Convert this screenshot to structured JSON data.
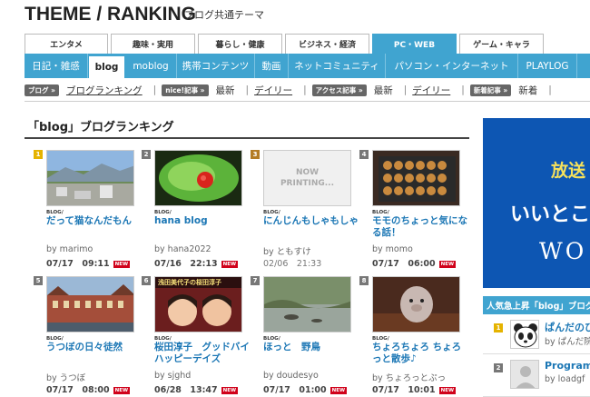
{
  "header": {
    "logo": "THEME / RANKING",
    "subtitle": "ブログ共通テーマ"
  },
  "category_tabs": [
    {
      "label": "エンタメ",
      "active": false
    },
    {
      "label": "趣味・実用",
      "active": false
    },
    {
      "label": "暮らし・健康",
      "active": false
    },
    {
      "label": "ビジネス・経済",
      "active": false
    },
    {
      "label": "PC・WEB",
      "active": true
    },
    {
      "label": "ゲーム・キャラ",
      "active": false
    }
  ],
  "sub_tabs": [
    {
      "label": "日記・雑感",
      "active": false
    },
    {
      "label": "blog",
      "active": true
    },
    {
      "label": "moblog",
      "active": false
    },
    {
      "label": "携帯コンテンツ",
      "active": false
    },
    {
      "label": "動画",
      "active": false
    },
    {
      "label": "ネットコミュニティ",
      "active": false
    },
    {
      "label": "パソコン・インターネット",
      "active": false
    },
    {
      "label": "PLAYLOG",
      "active": false
    }
  ],
  "filters": {
    "blog_badge": "ブログ »",
    "blog_ranking": "ブログランキング",
    "nice_badge": "nice!記事 »",
    "nice_latest": "最新",
    "nice_daily": "デイリー",
    "access_badge": "アクセス記事 »",
    "access_latest": "最新",
    "access_daily": "デイリー",
    "new_badge": "新着記事 »",
    "new_latest": "新着"
  },
  "section_title": "「blog」ブログランキング",
  "cards": [
    {
      "rank": "1",
      "category": "BLOG/",
      "title": "だって猫なんだもん",
      "by": "by marimo",
      "date": "07/17　09:11",
      "new": "NEW",
      "placeholder": ""
    },
    {
      "rank": "2",
      "category": "BLOG/",
      "title": "hana blog",
      "by": "by hana2022",
      "date": "07/16　22:13",
      "new": "NEW",
      "placeholder": ""
    },
    {
      "rank": "3",
      "category": "BLOG/",
      "title": "にんじんもしゃもしゃ",
      "by": "by ともすけ",
      "date": "02/06　21:33",
      "new": "",
      "placeholder": "NOW PRINTING..."
    },
    {
      "rank": "4",
      "category": "BLOG/",
      "title": "モモのちょっと気になる話！",
      "by": "by momo",
      "date": "07/17　06:00",
      "new": "NEW",
      "placeholder": ""
    },
    {
      "rank": "5",
      "category": "BLOG/",
      "title": "うつぼの日々徒然",
      "by": "by うつぼ",
      "date": "07/17　08:00",
      "new": "NEW",
      "placeholder": ""
    },
    {
      "rank": "6",
      "category": "BLOG/",
      "title": "桜田淳子　グッドバイハッピーデイズ",
      "by": "by sjghd",
      "date": "06/28　13:47",
      "new": "NEW",
      "placeholder": "",
      "thumb_text": "浅田美代子の桜田淳子"
    },
    {
      "rank": "7",
      "category": "BLOG/",
      "title": "ほっと　野鳥",
      "by": "by doudesyo",
      "date": "07/17　01:00",
      "new": "NEW",
      "placeholder": ""
    },
    {
      "rank": "8",
      "category": "BLOG/",
      "title": "ちょろちょろ ちょろっと散歩♪",
      "by": "by ちょろっとぷっ",
      "date": "07/17　10:01",
      "new": "NEW",
      "placeholder": ""
    }
  ],
  "ad": {
    "line1": "放送",
    "line2": "いいとこ",
    "line3": "WO"
  },
  "popular": {
    "title": "人気急上昇「blog」ブログ",
    "items": [
      {
        "rank": "1",
        "name": "ぱんだのひ",
        "by": "by ぱんだ院"
      },
      {
        "rank": "2",
        "name": "Program",
        "by": "by loadgf"
      }
    ]
  },
  "colors": {
    "accent": "#40a4d0",
    "link": "#1c77b5",
    "new_badge": "#d0021b",
    "ad_bg": "#0d56b3"
  }
}
